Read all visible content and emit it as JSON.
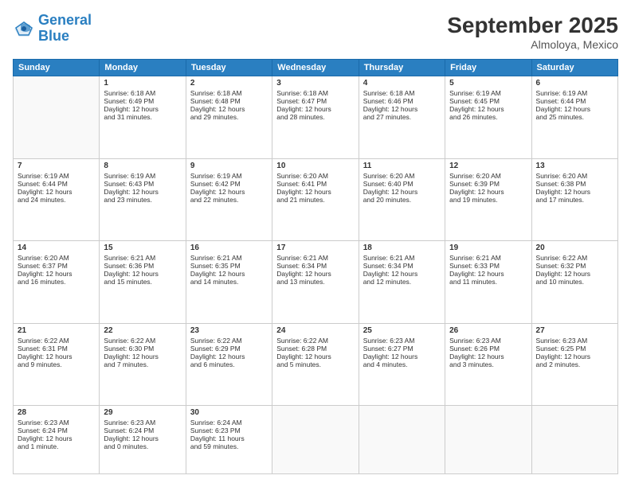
{
  "header": {
    "logo_line1": "General",
    "logo_line2": "Blue",
    "month": "September 2025",
    "location": "Almoloya, Mexico"
  },
  "days_of_week": [
    "Sunday",
    "Monday",
    "Tuesday",
    "Wednesday",
    "Thursday",
    "Friday",
    "Saturday"
  ],
  "weeks": [
    [
      {
        "day": "",
        "info": ""
      },
      {
        "day": "1",
        "info": "Sunrise: 6:18 AM\nSunset: 6:49 PM\nDaylight: 12 hours\nand 31 minutes."
      },
      {
        "day": "2",
        "info": "Sunrise: 6:18 AM\nSunset: 6:48 PM\nDaylight: 12 hours\nand 29 minutes."
      },
      {
        "day": "3",
        "info": "Sunrise: 6:18 AM\nSunset: 6:47 PM\nDaylight: 12 hours\nand 28 minutes."
      },
      {
        "day": "4",
        "info": "Sunrise: 6:18 AM\nSunset: 6:46 PM\nDaylight: 12 hours\nand 27 minutes."
      },
      {
        "day": "5",
        "info": "Sunrise: 6:19 AM\nSunset: 6:45 PM\nDaylight: 12 hours\nand 26 minutes."
      },
      {
        "day": "6",
        "info": "Sunrise: 6:19 AM\nSunset: 6:44 PM\nDaylight: 12 hours\nand 25 minutes."
      }
    ],
    [
      {
        "day": "7",
        "info": "Sunrise: 6:19 AM\nSunset: 6:44 PM\nDaylight: 12 hours\nand 24 minutes."
      },
      {
        "day": "8",
        "info": "Sunrise: 6:19 AM\nSunset: 6:43 PM\nDaylight: 12 hours\nand 23 minutes."
      },
      {
        "day": "9",
        "info": "Sunrise: 6:19 AM\nSunset: 6:42 PM\nDaylight: 12 hours\nand 22 minutes."
      },
      {
        "day": "10",
        "info": "Sunrise: 6:20 AM\nSunset: 6:41 PM\nDaylight: 12 hours\nand 21 minutes."
      },
      {
        "day": "11",
        "info": "Sunrise: 6:20 AM\nSunset: 6:40 PM\nDaylight: 12 hours\nand 20 minutes."
      },
      {
        "day": "12",
        "info": "Sunrise: 6:20 AM\nSunset: 6:39 PM\nDaylight: 12 hours\nand 19 minutes."
      },
      {
        "day": "13",
        "info": "Sunrise: 6:20 AM\nSunset: 6:38 PM\nDaylight: 12 hours\nand 17 minutes."
      }
    ],
    [
      {
        "day": "14",
        "info": "Sunrise: 6:20 AM\nSunset: 6:37 PM\nDaylight: 12 hours\nand 16 minutes."
      },
      {
        "day": "15",
        "info": "Sunrise: 6:21 AM\nSunset: 6:36 PM\nDaylight: 12 hours\nand 15 minutes."
      },
      {
        "day": "16",
        "info": "Sunrise: 6:21 AM\nSunset: 6:35 PM\nDaylight: 12 hours\nand 14 minutes."
      },
      {
        "day": "17",
        "info": "Sunrise: 6:21 AM\nSunset: 6:34 PM\nDaylight: 12 hours\nand 13 minutes."
      },
      {
        "day": "18",
        "info": "Sunrise: 6:21 AM\nSunset: 6:34 PM\nDaylight: 12 hours\nand 12 minutes."
      },
      {
        "day": "19",
        "info": "Sunrise: 6:21 AM\nSunset: 6:33 PM\nDaylight: 12 hours\nand 11 minutes."
      },
      {
        "day": "20",
        "info": "Sunrise: 6:22 AM\nSunset: 6:32 PM\nDaylight: 12 hours\nand 10 minutes."
      }
    ],
    [
      {
        "day": "21",
        "info": "Sunrise: 6:22 AM\nSunset: 6:31 PM\nDaylight: 12 hours\nand 9 minutes."
      },
      {
        "day": "22",
        "info": "Sunrise: 6:22 AM\nSunset: 6:30 PM\nDaylight: 12 hours\nand 7 minutes."
      },
      {
        "day": "23",
        "info": "Sunrise: 6:22 AM\nSunset: 6:29 PM\nDaylight: 12 hours\nand 6 minutes."
      },
      {
        "day": "24",
        "info": "Sunrise: 6:22 AM\nSunset: 6:28 PM\nDaylight: 12 hours\nand 5 minutes."
      },
      {
        "day": "25",
        "info": "Sunrise: 6:23 AM\nSunset: 6:27 PM\nDaylight: 12 hours\nand 4 minutes."
      },
      {
        "day": "26",
        "info": "Sunrise: 6:23 AM\nSunset: 6:26 PM\nDaylight: 12 hours\nand 3 minutes."
      },
      {
        "day": "27",
        "info": "Sunrise: 6:23 AM\nSunset: 6:25 PM\nDaylight: 12 hours\nand 2 minutes."
      }
    ],
    [
      {
        "day": "28",
        "info": "Sunrise: 6:23 AM\nSunset: 6:24 PM\nDaylight: 12 hours\nand 1 minute."
      },
      {
        "day": "29",
        "info": "Sunrise: 6:23 AM\nSunset: 6:24 PM\nDaylight: 12 hours\nand 0 minutes."
      },
      {
        "day": "30",
        "info": "Sunrise: 6:24 AM\nSunset: 6:23 PM\nDaylight: 11 hours\nand 59 minutes."
      },
      {
        "day": "",
        "info": ""
      },
      {
        "day": "",
        "info": ""
      },
      {
        "day": "",
        "info": ""
      },
      {
        "day": "",
        "info": ""
      }
    ]
  ]
}
